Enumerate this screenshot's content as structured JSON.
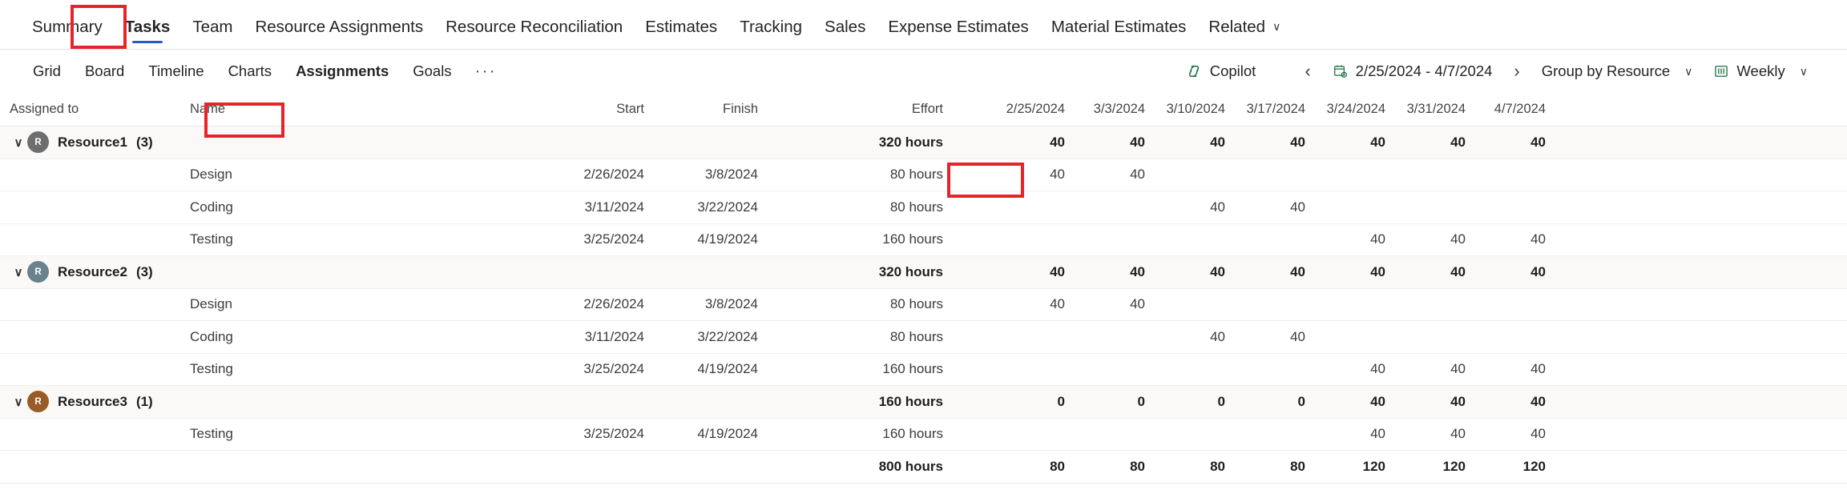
{
  "entity_tabs": [
    {
      "label": "Summary",
      "selected": false,
      "dropdown": false
    },
    {
      "label": "Tasks",
      "selected": true,
      "dropdown": false
    },
    {
      "label": "Team",
      "selected": false,
      "dropdown": false
    },
    {
      "label": "Resource Assignments",
      "selected": false,
      "dropdown": false
    },
    {
      "label": "Resource Reconciliation",
      "selected": false,
      "dropdown": false
    },
    {
      "label": "Estimates",
      "selected": false,
      "dropdown": false
    },
    {
      "label": "Tracking",
      "selected": false,
      "dropdown": false
    },
    {
      "label": "Sales",
      "selected": false,
      "dropdown": false
    },
    {
      "label": "Expense Estimates",
      "selected": false,
      "dropdown": false
    },
    {
      "label": "Material Estimates",
      "selected": false,
      "dropdown": false
    },
    {
      "label": "Related",
      "selected": false,
      "dropdown": true
    }
  ],
  "view_tabs": [
    {
      "label": "Grid",
      "selected": false
    },
    {
      "label": "Board",
      "selected": false
    },
    {
      "label": "Timeline",
      "selected": false
    },
    {
      "label": "Charts",
      "selected": false
    },
    {
      "label": "Assignments",
      "selected": true
    },
    {
      "label": "Goals",
      "selected": false
    }
  ],
  "view_more_label": "···",
  "toolbar": {
    "copilot_label": "Copilot",
    "prev_label": "‹",
    "next_label": "›",
    "date_range": "2/25/2024 - 4/7/2024",
    "group_by_label": "Group by Resource",
    "period_label": "Weekly",
    "chevron": "∨"
  },
  "colors": {
    "accent_blue": "#2b59c3",
    "annotation_red": "#e8232a",
    "copilot_green": "#1d7044",
    "avatar_resource1": "#6e6e6e",
    "avatar_resource2": "#68828e",
    "avatar_resource3": "#9a5c27"
  },
  "grid": {
    "columns": {
      "assigned_to": "Assigned to",
      "name": "Name",
      "start": "Start",
      "finish": "Finish",
      "effort": "Effort"
    },
    "week_columns": [
      "2/25/2024",
      "3/3/2024",
      "3/10/2024",
      "3/17/2024",
      "3/24/2024",
      "3/31/2024",
      "4/7/2024"
    ],
    "groups": [
      {
        "avatar_initial": "R",
        "avatar_color": "#6e6e6e",
        "name": "Resource1",
        "count": "(3)",
        "effort": "320 hours",
        "weeks": [
          "40",
          "40",
          "40",
          "40",
          "40",
          "40",
          "40"
        ],
        "caret": "∨",
        "tasks": [
          {
            "name": "Design",
            "start": "2/26/2024",
            "finish": "3/8/2024",
            "effort": "80 hours",
            "weeks": [
              "40",
              "40",
              "",
              "",
              "",
              "",
              ""
            ]
          },
          {
            "name": "Coding",
            "start": "3/11/2024",
            "finish": "3/22/2024",
            "effort": "80 hours",
            "weeks": [
              "",
              "",
              "40",
              "40",
              "",
              "",
              ""
            ]
          },
          {
            "name": "Testing",
            "start": "3/25/2024",
            "finish": "4/19/2024",
            "effort": "160 hours",
            "weeks": [
              "",
              "",
              "",
              "",
              "40",
              "40",
              "40"
            ]
          }
        ]
      },
      {
        "avatar_initial": "R",
        "avatar_color": "#68828e",
        "name": "Resource2",
        "count": "(3)",
        "effort": "320 hours",
        "weeks": [
          "40",
          "40",
          "40",
          "40",
          "40",
          "40",
          "40"
        ],
        "caret": "∨",
        "tasks": [
          {
            "name": "Design",
            "start": "2/26/2024",
            "finish": "3/8/2024",
            "effort": "80 hours",
            "weeks": [
              "40",
              "40",
              "",
              "",
              "",
              "",
              ""
            ]
          },
          {
            "name": "Coding",
            "start": "3/11/2024",
            "finish": "3/22/2024",
            "effort": "80 hours",
            "weeks": [
              "",
              "",
              "40",
              "40",
              "",
              "",
              ""
            ]
          },
          {
            "name": "Testing",
            "start": "3/25/2024",
            "finish": "4/19/2024",
            "effort": "160 hours",
            "weeks": [
              "",
              "",
              "",
              "",
              "40",
              "40",
              "40"
            ]
          }
        ]
      },
      {
        "avatar_initial": "R",
        "avatar_color": "#9a5c27",
        "name": "Resource3",
        "count": "(1)",
        "effort": "160 hours",
        "weeks": [
          "0",
          "0",
          "0",
          "0",
          "40",
          "40",
          "40"
        ],
        "caret": "∨",
        "tasks": [
          {
            "name": "Testing",
            "start": "3/25/2024",
            "finish": "4/19/2024",
            "effort": "160 hours",
            "weeks": [
              "",
              "",
              "",
              "",
              "40",
              "40",
              "40"
            ]
          }
        ]
      }
    ],
    "total_row": {
      "effort": "800 hours",
      "weeks": [
        "80",
        "80",
        "80",
        "80",
        "120",
        "120",
        "120"
      ]
    }
  }
}
